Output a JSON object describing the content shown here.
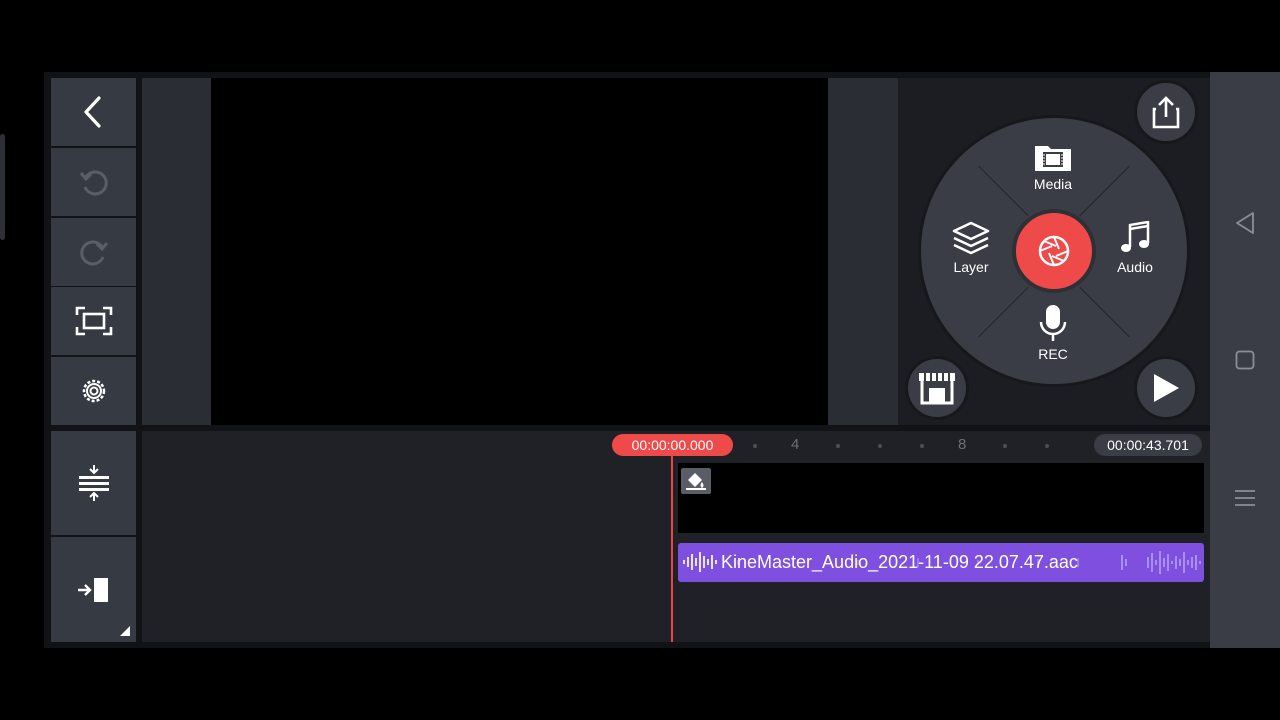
{
  "editor": {
    "toolbar": {
      "back": "back-icon",
      "undo": "undo-icon",
      "redo": "redo-icon",
      "fullscreen": "fullscreen-icon",
      "settings": "gear-icon",
      "expand_timeline": "expand-timeline-icon",
      "jump_to_start": "jump-to-start-icon"
    },
    "media_wheel": {
      "media_label": "Media",
      "layer_label": "Layer",
      "audio_label": "Audio",
      "rec_label": "REC"
    },
    "timeline": {
      "current_time": "00:00:00.000",
      "total_time": "00:00:43.701",
      "ruler_marks": [
        "4",
        "8"
      ],
      "audio_clip_name": "KineMaster_Audio_2021-11-09 22.07.47.aac"
    }
  },
  "colors": {
    "accent_red": "#ee4a4a",
    "audio_clip": "#7f4fe0",
    "panel": "#363a42"
  }
}
